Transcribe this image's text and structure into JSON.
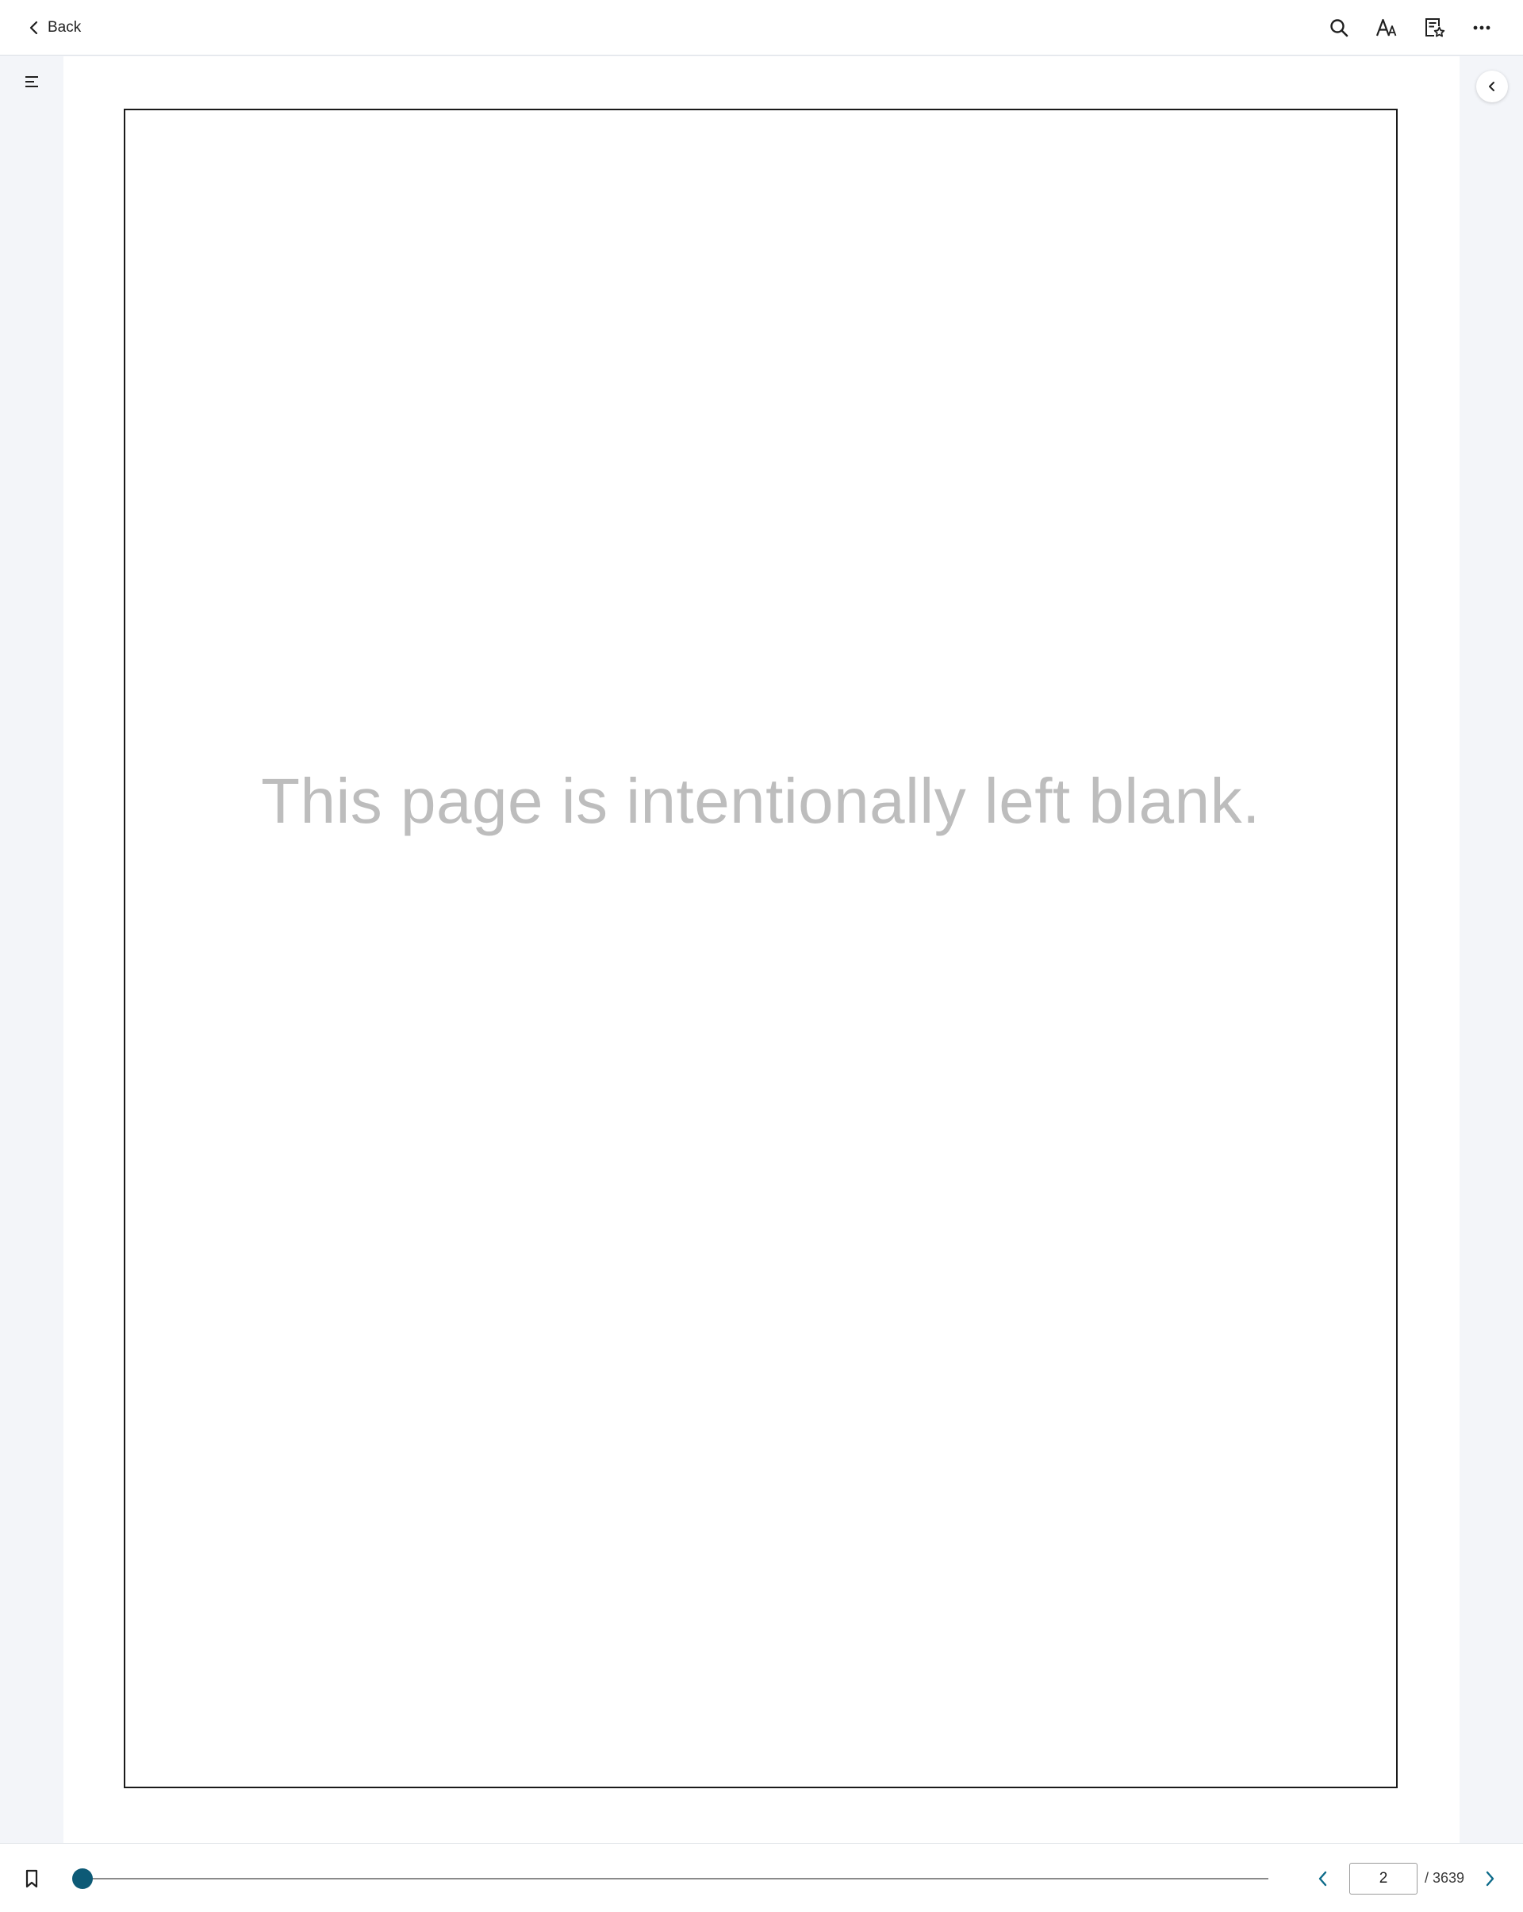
{
  "header": {
    "back_label": "Back",
    "icons": [
      "search-icon",
      "text-size-icon",
      "favorite-list-icon",
      "more-options-icon"
    ]
  },
  "sidebar": {
    "toc_icon": "table-of-contents-icon",
    "collapse_icon": "chevron-left-icon"
  },
  "page": {
    "blank_message": "This page is intentionally left blank."
  },
  "footer": {
    "bookmark_icon": "bookmark-icon",
    "current_page": "2",
    "total_pages": "/ 3639",
    "progress_fraction": 0.0003,
    "accent_color": "#0d5a76",
    "nav_color": "#0d6b8a"
  }
}
